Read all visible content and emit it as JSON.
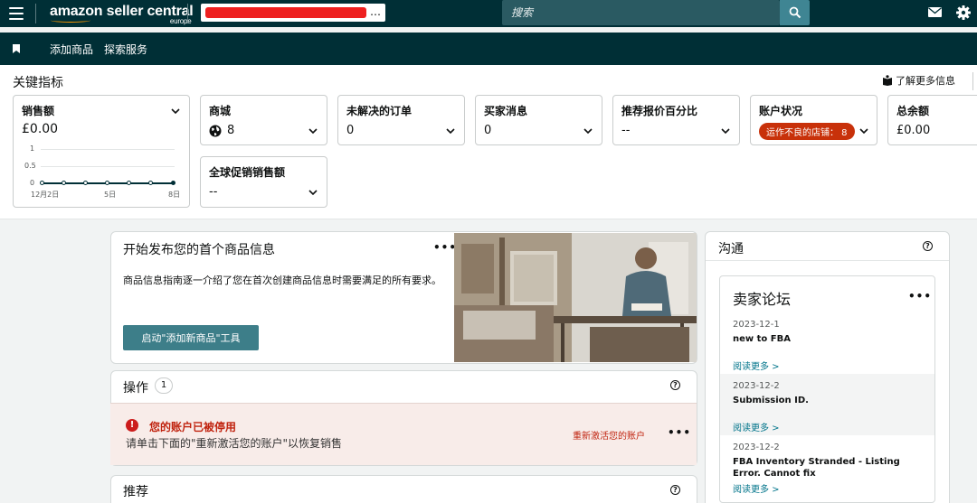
{
  "header": {
    "logo_main": "amazon seller central",
    "logo_sub": "europe",
    "store_selector_suffix": "…",
    "search_placeholder": "搜索"
  },
  "nav": {
    "items": [
      "添加商品",
      "探索服务"
    ]
  },
  "metrics": {
    "title": "关键指标",
    "learn_more": "了解更多信息",
    "sales": {
      "label": "销售额",
      "value": "£0.00",
      "chart": {
        "y_ticks": [
          "1",
          "0.5",
          "0"
        ],
        "x_ticks": [
          "12月2日",
          "5日",
          "8日"
        ]
      }
    },
    "marketplaces": {
      "label": "商城",
      "value": "8"
    },
    "open_orders": {
      "label": "未解决的订单",
      "value": "0"
    },
    "buyer_messages": {
      "label": "买家消息",
      "value": "0"
    },
    "featured_offer": {
      "label": "推荐报价百分比",
      "value": "--"
    },
    "account_health": {
      "label": "账户状况",
      "badge": "运作不良的店铺：  8"
    },
    "total_balance": {
      "label": "总余额",
      "value": "£0.00"
    },
    "global_promo": {
      "label": "全球促销销售额",
      "value": "--"
    }
  },
  "listing_card": {
    "title": "开始发布您的首个商品信息",
    "description": "商品信息指南逐一介绍了您在首次创建商品信息时需要满足的所有要求。",
    "button": "启动\"添加新商品\"工具"
  },
  "actions": {
    "title": "操作",
    "count": "1",
    "alert_title": "您的账户已被停用",
    "alert_desc": "请单击下面的\"重新激活您的账户\"以恢复销售",
    "alert_link": "重新激活您的账户"
  },
  "recommendations": {
    "title": "推荐"
  },
  "communication": {
    "title": "沟通",
    "forum_title": "卖家论坛",
    "posts": [
      {
        "date": "2023-12-1",
        "title": "new to FBA",
        "read_more": "阅读更多 >"
      },
      {
        "date": "2023-12-2",
        "title": "Submission ID.",
        "read_more": "阅读更多 >"
      },
      {
        "date": "2023-12-2",
        "title": "FBA Inventory Stranded - Listing Error. Cannot fix",
        "read_more": "阅读更多 >"
      }
    ]
  }
}
